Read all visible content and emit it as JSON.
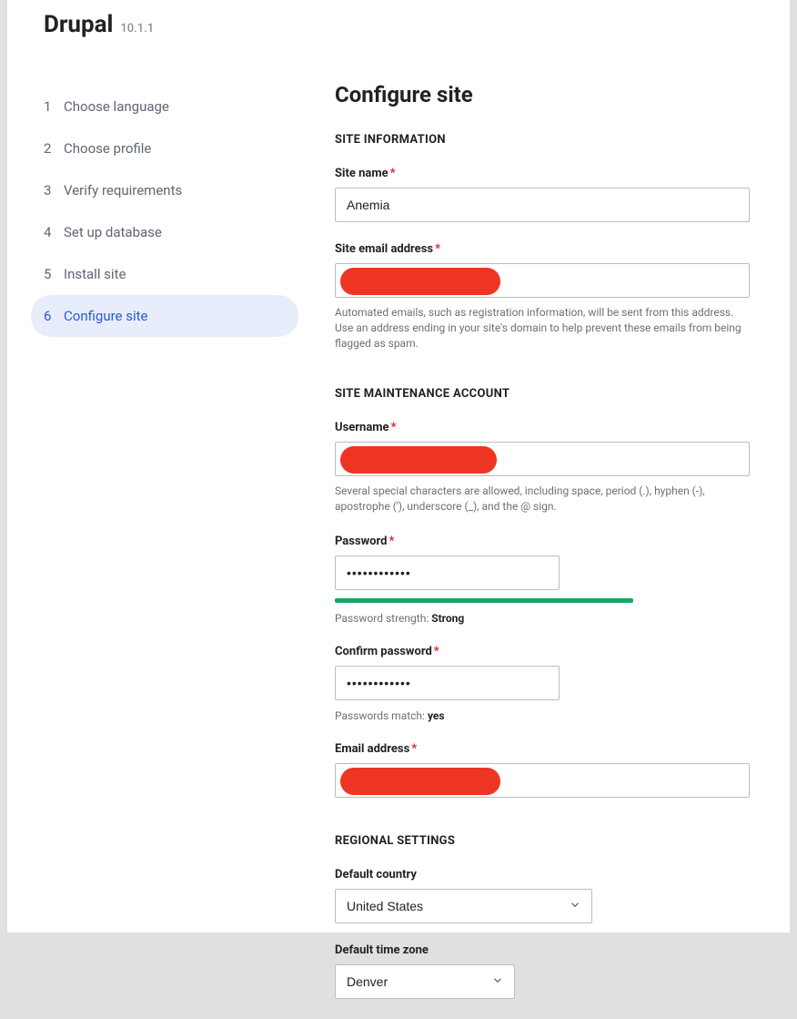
{
  "header": {
    "brand": "Drupal",
    "version": "10.1.1"
  },
  "sidebar": {
    "steps": [
      {
        "num": "1",
        "label": "Choose language"
      },
      {
        "num": "2",
        "label": "Choose profile"
      },
      {
        "num": "3",
        "label": "Verify requirements"
      },
      {
        "num": "4",
        "label": "Set up database"
      },
      {
        "num": "5",
        "label": "Install site"
      },
      {
        "num": "6",
        "label": "Configure site"
      }
    ],
    "active_index": 5
  },
  "page": {
    "title": "Configure site"
  },
  "sections": {
    "site_info": {
      "title": "SITE INFORMATION",
      "site_name_label": "Site name",
      "site_name_value": "Anemia",
      "site_email_label": "Site email address",
      "site_email_value": "",
      "site_email_help": "Automated emails, such as registration information, will be sent from this address. Use an address ending in your site's domain to help prevent these emails from being flagged as spam."
    },
    "maintenance": {
      "title": "SITE MAINTENANCE ACCOUNT",
      "username_label": "Username",
      "username_value": "",
      "username_help": "Several special characters are allowed, including space, period (.), hyphen (-), apostrophe ('), underscore (_), and the @ sign.",
      "password_label": "Password",
      "password_value": "••••••••••••",
      "strength_label": "Password strength: ",
      "strength_value": "Strong",
      "confirm_label": "Confirm password",
      "confirm_value": "••••••••••••",
      "match_label": "Passwords match: ",
      "match_value": "yes",
      "email_label": "Email address",
      "email_value": ""
    },
    "regional": {
      "title": "REGIONAL SETTINGS",
      "country_label": "Default country",
      "country_value": "United States",
      "timezone_label": "Default time zone",
      "timezone_value": "Denver"
    }
  }
}
